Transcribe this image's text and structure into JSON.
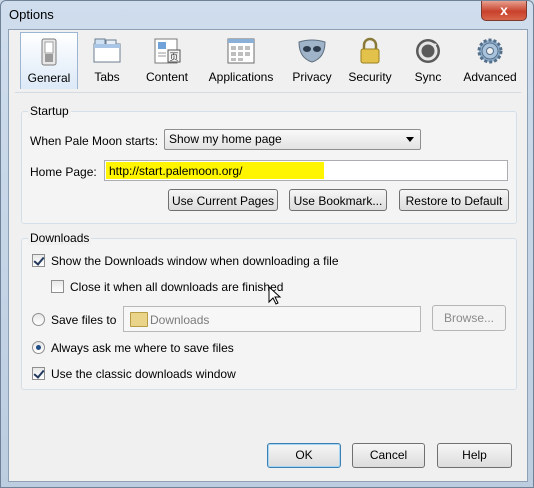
{
  "window": {
    "title": "Options",
    "close_label": "x"
  },
  "toolbar": {
    "tabs": [
      {
        "label": "General",
        "icon": "switch-icon"
      },
      {
        "label": "Tabs",
        "icon": "tabs-icon"
      },
      {
        "label": "Content",
        "icon": "content-icon"
      },
      {
        "label": "Applications",
        "icon": "applications-icon"
      },
      {
        "label": "Privacy",
        "icon": "mask-icon"
      },
      {
        "label": "Security",
        "icon": "lock-icon"
      },
      {
        "label": "Sync",
        "icon": "sync-icon"
      },
      {
        "label": "Advanced",
        "icon": "gear-icon"
      }
    ],
    "selected": "General"
  },
  "startup": {
    "group_label": "Startup",
    "when_starts_label": "When Pale Moon starts:",
    "when_starts_value": "Show my home page",
    "home_page_label": "Home Page:",
    "home_page_value": "http://start.palemoon.org/",
    "use_current_pages": "Use Current Pages",
    "use_bookmark": "Use Bookmark...",
    "restore_default": "Restore to Default"
  },
  "downloads": {
    "group_label": "Downloads",
    "show_window_label": "Show the Downloads window when downloading a file",
    "show_window_checked": true,
    "close_when_done_label": "Close it when all downloads are finished",
    "close_when_done_checked": false,
    "save_files_to_label": "Save files to",
    "save_files_to_selected": false,
    "folder_value": "Downloads",
    "browse_label": "Browse...",
    "always_ask_label": "Always ask me where to save files",
    "always_ask_selected": true,
    "classic_window_label": "Use the classic downloads window",
    "classic_window_checked": true
  },
  "footer": {
    "ok": "OK",
    "cancel": "Cancel",
    "help": "Help"
  },
  "colors": {
    "highlight": "#fff500",
    "selected_tab": "#dce9f7"
  }
}
